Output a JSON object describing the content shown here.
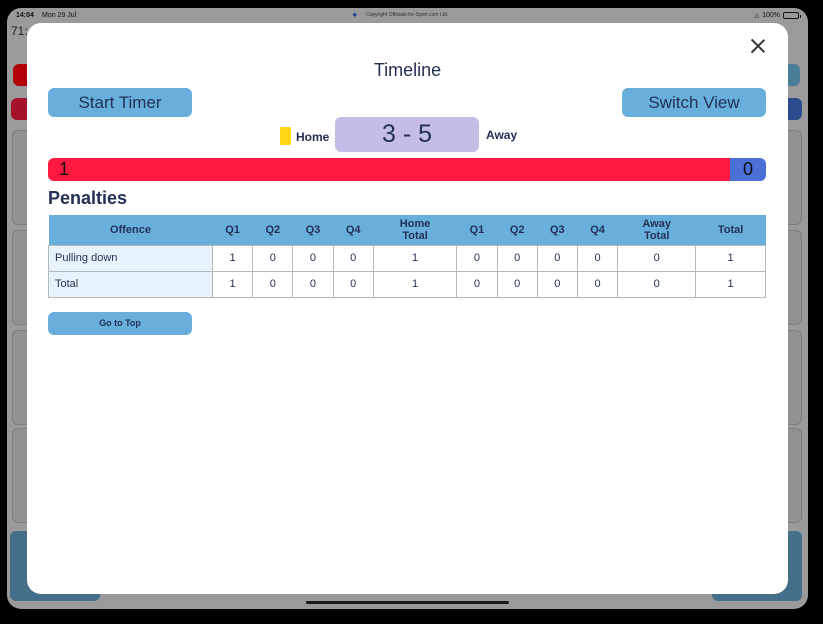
{
  "status_bar": {
    "time": "14:04",
    "date": "Mon 29 Jul",
    "copyright": "Copyright Officials-for-Sport.com Ltd.",
    "battery": "100%"
  },
  "background": {
    "clock_fragment": "71:"
  },
  "modal": {
    "title": "Timeline",
    "start_timer_label": "Start Timer",
    "switch_view_label": "Switch View",
    "home_label": "Home",
    "away_label": "Away",
    "score": "3 - 5",
    "home_card_color": "#ffd712",
    "possession": {
      "home_value": "1",
      "away_value": "0",
      "home_color": "#ff1940",
      "away_color": "#4a6fd6"
    },
    "penalties": {
      "heading": "Penalties",
      "columns": [
        "Offence",
        "Q1",
        "Q2",
        "Q3",
        "Q4",
        "Home Total",
        "Q1",
        "Q2",
        "Q3",
        "Q4",
        "Away Total",
        "Total"
      ],
      "rows": [
        [
          "Pulling down",
          "1",
          "0",
          "0",
          "0",
          "1",
          "0",
          "0",
          "0",
          "0",
          "0",
          "1"
        ],
        [
          "Total",
          "1",
          "0",
          "0",
          "0",
          "1",
          "0",
          "0",
          "0",
          "0",
          "0",
          "1"
        ]
      ]
    },
    "go_to_top_label": "Go to Top"
  }
}
